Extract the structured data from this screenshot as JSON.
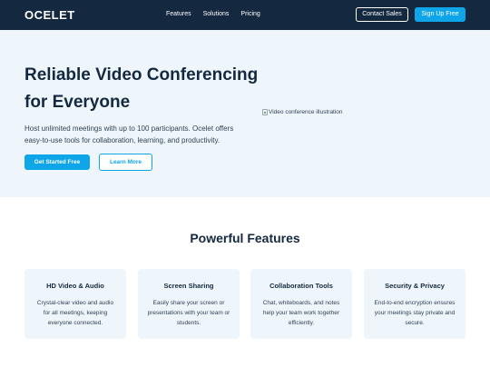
{
  "nav": {
    "logo": "OCELET",
    "links": [
      "Features",
      "Solutions",
      "Pricing"
    ],
    "contact_label": "Contact Sales",
    "signup_label": "Sign Up Free"
  },
  "hero": {
    "title": "Reliable Video Conferencing for Everyone",
    "description": "Host unlimited meetings with up to 100 participants. Ocelet offers easy-to-use tools for collaboration, learning, and productivity.",
    "primary_button": "Get Started Free",
    "secondary_button": "Learn More",
    "image_alt": "Video conference illustration"
  },
  "features": {
    "title": "Powerful Features",
    "cards": [
      {
        "title": "HD Video & Audio",
        "text": "Crystal-clear video and audio for all meetings, keeping everyone connected."
      },
      {
        "title": "Screen Sharing",
        "text": "Easily share your screen or presentations with your team or students."
      },
      {
        "title": "Collaboration Tools",
        "text": "Chat, whiteboards, and notes help your team work together efficiently."
      },
      {
        "title": "Security & Privacy",
        "text": "End-to-end encryption ensures your meetings stay private and secure."
      }
    ]
  },
  "colors": {
    "navbar": "#14283f",
    "accent": "#0ea5e9",
    "hero_bg": "#eef6fc",
    "card_bg": "#eef6fc"
  },
  "icons": {
    "broken_image": "broken-image-icon"
  }
}
